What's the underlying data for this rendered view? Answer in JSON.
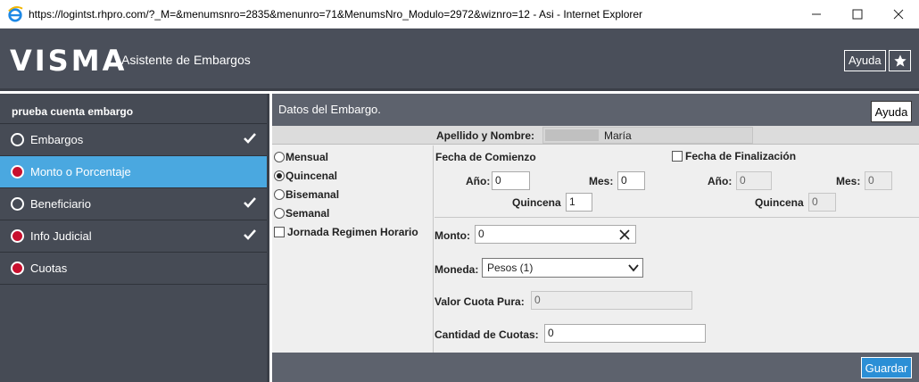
{
  "window": {
    "title": "https://logintst.rhpro.com/?_M=&menumsnro=2835&menunro=71&MenumsNro_Modulo=2972&wiznro=12 - Asi - Internet Explorer",
    "icon": "internet-explorer-icon"
  },
  "header": {
    "logo": "VISMA",
    "title": "Asistente de Embargos",
    "help_label": "Ayuda",
    "star_icon": "star-icon"
  },
  "sidebar": {
    "title": "prueba cuenta embargo",
    "items": [
      {
        "label": "Embargos",
        "status": "empty",
        "checked": true
      },
      {
        "label": "Monto o Porcentaje",
        "status": "red",
        "checked": false,
        "active": true
      },
      {
        "label": "Beneficiario",
        "status": "empty",
        "checked": true
      },
      {
        "label": "Info Judicial",
        "status": "red",
        "checked": true
      },
      {
        "label": "Cuotas",
        "status": "red",
        "checked": false
      }
    ]
  },
  "panel": {
    "title": "Datos del Embargo.",
    "help_label": "Ayuda",
    "name_label": "Apellido y Nombre:",
    "name_value": "María",
    "frequency": {
      "options": [
        "Mensual",
        "Quincenal",
        "Bisemanal",
        "Semanal"
      ],
      "selected": "Quincenal"
    },
    "jornada_label": "Jornada Regimen Horario",
    "start": {
      "title": "Fecha de Comienzo",
      "year_label": "Año:",
      "year_value": "0",
      "month_label": "Mes:",
      "month_value": "0",
      "fortnight_label": "Quincena",
      "fortnight_value": "1"
    },
    "end": {
      "title": "Fecha de Finalización",
      "year_label": "Año:",
      "year_value": "0",
      "month_label": "Mes:",
      "month_value": "0",
      "fortnight_label": "Quincena",
      "fortnight_value": "0"
    },
    "amount_label": "Monto:",
    "amount_value": "0",
    "currency_label": "Moneda:",
    "currency_value": "Pesos (1)",
    "pure_quota_label": "Valor Cuota Pura:",
    "pure_quota_value": "0",
    "quota_count_label": "Cantidad de Cuotas:",
    "quota_count_value": "0",
    "save_label": "Guardar"
  },
  "colors": {
    "header_bg": "#4a4f5a",
    "sidebar_bg": "#464b55",
    "active_item": "#4aa8e0",
    "status_red": "#c8102e",
    "save_button": "#2b8fd6"
  }
}
